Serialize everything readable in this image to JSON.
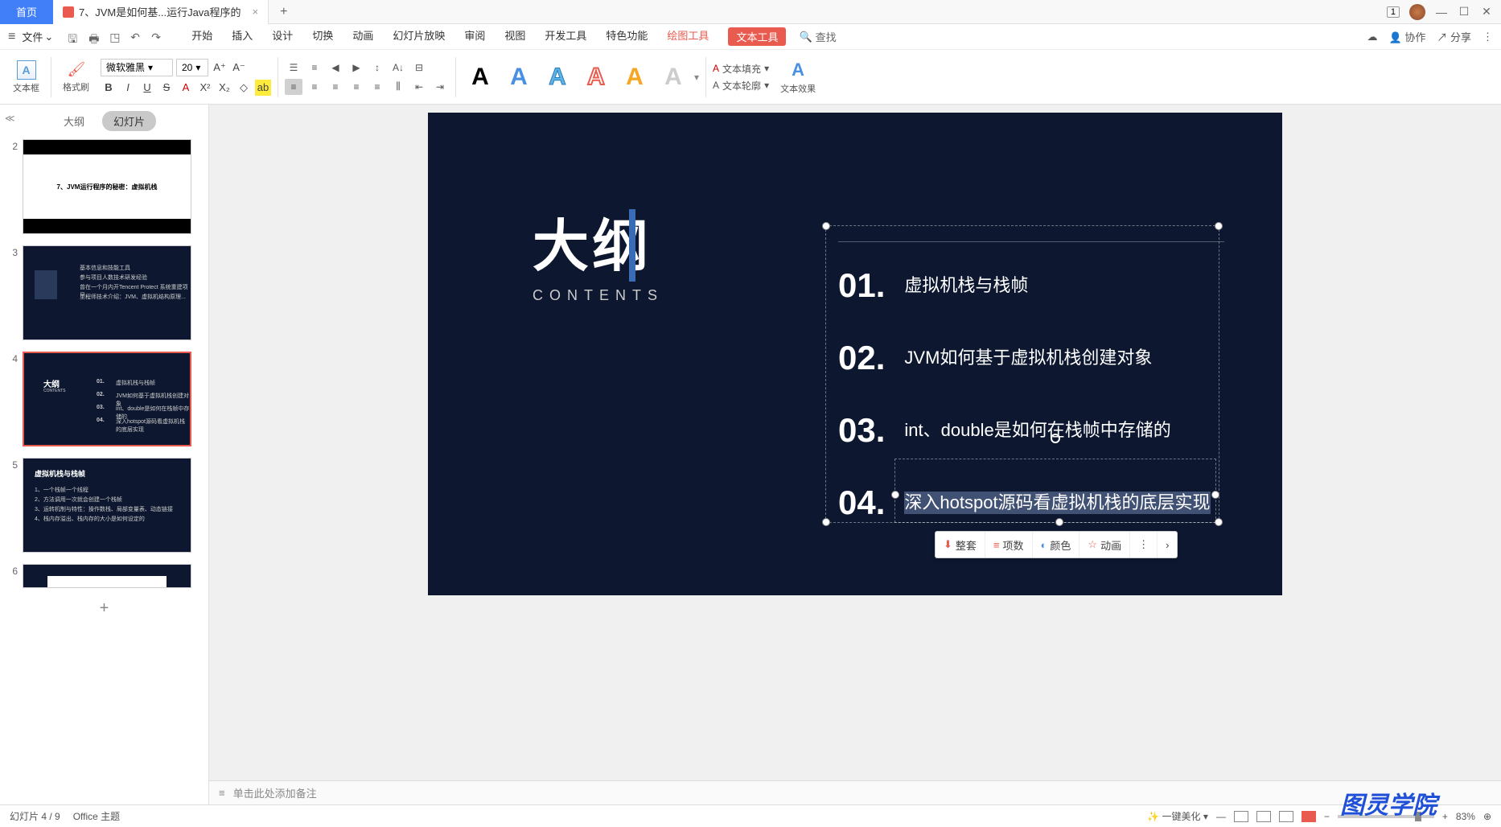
{
  "titlebar": {
    "home": "首页",
    "file_tab": "7、JVM是如何基...运行Java程序的",
    "win_badge": "1"
  },
  "menubar": {
    "file": "文件",
    "tabs": {
      "start": "开始",
      "insert": "插入",
      "design": "设计",
      "transition": "切换",
      "animation": "动画",
      "slideshow": "幻灯片放映",
      "review": "审阅",
      "view": "视图",
      "dev": "开发工具",
      "special": "特色功能",
      "drawing": "绘图工具",
      "text_tool": "文本工具"
    },
    "search": "查找",
    "collab": "协作",
    "share": "分享"
  },
  "ribbon": {
    "textbox": "文本框",
    "format_painter": "格式刷",
    "font_name": "微软雅黑",
    "font_size": "20",
    "text_fill": "文本填充",
    "text_outline": "文本轮廓",
    "text_effects": "文本效果"
  },
  "thumb": {
    "outline": "大纲",
    "slides": "幻灯片",
    "slide2_title": "7、JVM运行程序的秘密：虚拟机栈",
    "slide4_title": "大纲",
    "slide4_sub": "CONTENTS",
    "slide5_title": "虚拟机栈与栈帧"
  },
  "slide": {
    "title": "大纲",
    "subtitle": "CONTENTS",
    "items": [
      {
        "num": "01.",
        "text": "虚拟机栈与栈帧"
      },
      {
        "num": "02.",
        "text": "JVM如何基于虚拟机栈创建对象"
      },
      {
        "num": "03.",
        "text": "int、double是如何在栈帧中存储的"
      },
      {
        "num": "04.",
        "text": "深入hotspot源码看虚拟机栈的底层实现"
      }
    ]
  },
  "ctx": {
    "full": "整套",
    "items": "项数",
    "color": "颜色",
    "anim": "动画"
  },
  "notes": {
    "placeholder": "单击此处添加备注"
  },
  "status": {
    "slide_pos": "幻灯片 4 / 9",
    "theme": "Office 主题",
    "beautify": "一键美化",
    "zoom": "83%"
  },
  "watermark": "图灵学院"
}
